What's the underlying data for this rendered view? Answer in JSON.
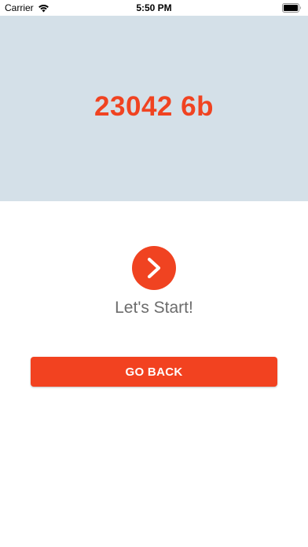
{
  "status_bar": {
    "carrier": "Carrier",
    "time": "5:50 PM",
    "icons": {
      "wifi": "wifi-icon",
      "battery": "battery-icon"
    }
  },
  "hero": {
    "code": "23042 6b",
    "background_color": "#d4e0e8",
    "text_color": "#f04321"
  },
  "start": {
    "icon": "chevron-right-icon",
    "label": "Let's Start!",
    "color": "#f04321"
  },
  "go_back": {
    "label": "GO BACK",
    "color": "#f24220"
  }
}
